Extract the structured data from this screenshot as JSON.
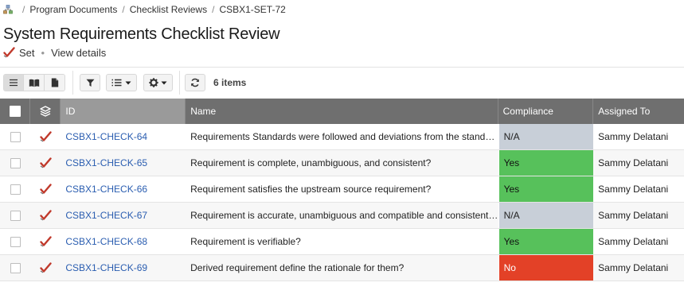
{
  "breadcrumb": {
    "items": [
      "Program Documents",
      "Checklist Reviews",
      "CSBX1-SET-72"
    ]
  },
  "page": {
    "title": "System Requirements Checklist Review",
    "type_label": "Set",
    "view_details": "View details"
  },
  "toolbar": {
    "item_count": "6 items"
  },
  "table": {
    "columns": {
      "id": "ID",
      "name": "Name",
      "compliance": "Compliance",
      "assigned": "Assigned To"
    },
    "rows": [
      {
        "id": "CSBX1-CHECK-64",
        "name": "Requirements Standards were followed and deviations from the standards were justified?",
        "compliance": "N/A",
        "compliance_status": "na",
        "assigned": "Sammy Delatani"
      },
      {
        "id": "CSBX1-CHECK-65",
        "name": "Requirement is complete, unambiguous, and consistent?",
        "compliance": "Yes",
        "compliance_status": "yes",
        "assigned": "Sammy Delatani"
      },
      {
        "id": "CSBX1-CHECK-66",
        "name": "Requirement satisfies the upstream source requirement?",
        "compliance": "Yes",
        "compliance_status": "yes",
        "assigned": "Sammy Delatani"
      },
      {
        "id": "CSBX1-CHECK-67",
        "name": "Requirement is accurate, unambiguous and compatible and consistent with the system?",
        "compliance": "N/A",
        "compliance_status": "na",
        "assigned": "Sammy Delatani"
      },
      {
        "id": "CSBX1-CHECK-68",
        "name": "Requirement is verifiable?",
        "compliance": "Yes",
        "compliance_status": "yes",
        "assigned": "Sammy Delatani"
      },
      {
        "id": "CSBX1-CHECK-69",
        "name": "Derived requirement define the rationale for them?",
        "compliance": "No",
        "compliance_status": "no",
        "assigned": "Sammy Delatani"
      }
    ]
  },
  "colors": {
    "compliance_na": "#c8cfd8",
    "compliance_yes": "#57c15b",
    "compliance_no": "#e34127",
    "header_bg": "#6f6f6f",
    "link": "#2a5db0",
    "check_red": "#c0392b"
  },
  "icons": {
    "home": "org-tree-icon",
    "type": "red-check-icon",
    "list_view": "list-icon",
    "book_view": "book-icon",
    "doc_view": "document-icon",
    "filter": "filter-icon",
    "sort": "list-sort-icon",
    "settings": "gear-icon",
    "refresh": "refresh-icon",
    "header_col": "layers-icon"
  }
}
